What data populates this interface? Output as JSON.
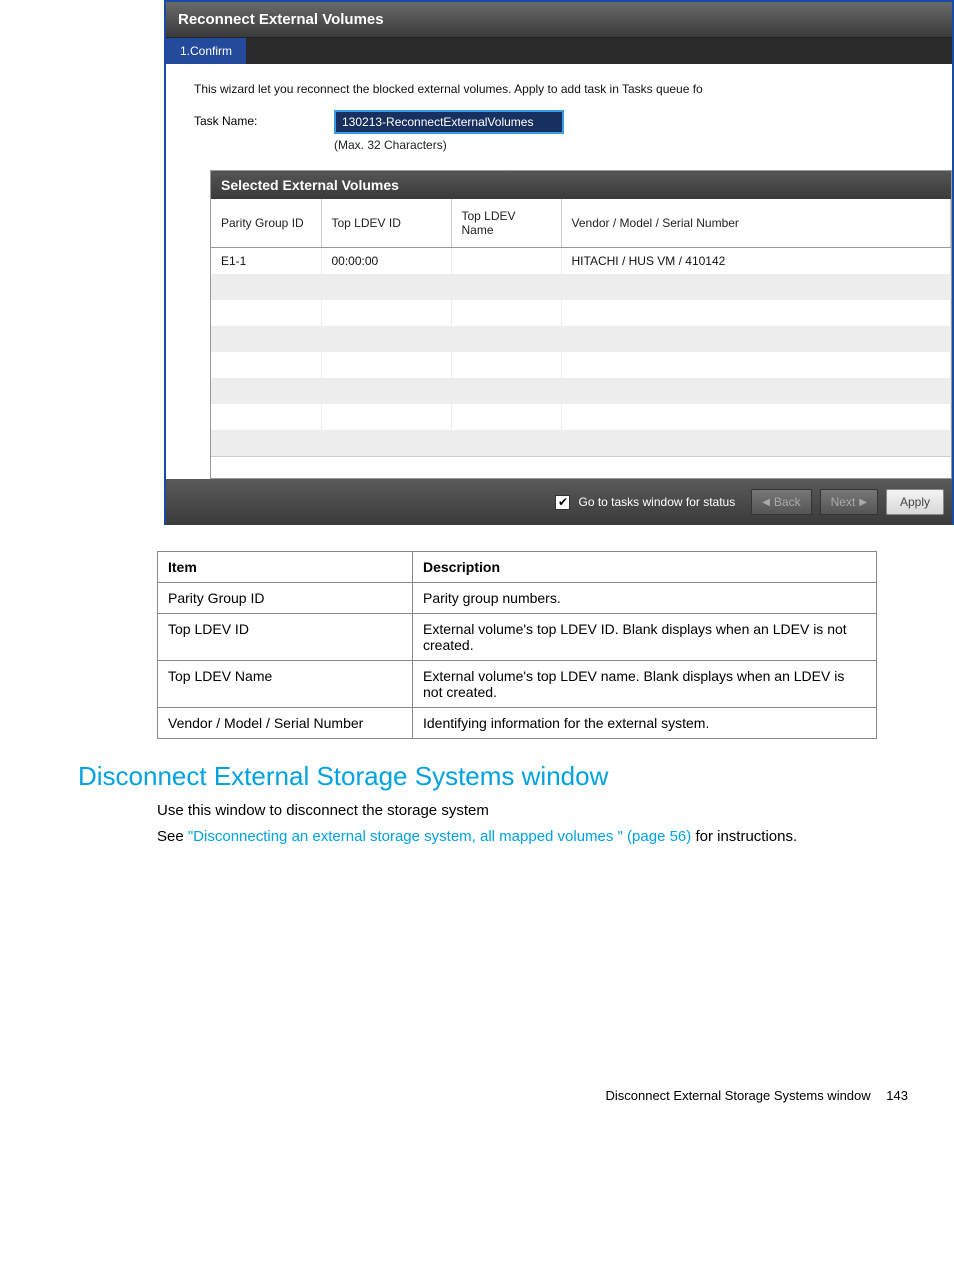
{
  "wizard": {
    "title": "Reconnect External Volumes",
    "tab": "1.Confirm",
    "intro": "This wizard let you reconnect the blocked external volumes. Apply to add task in Tasks queue fo",
    "task_label": "Task Name:",
    "task_value": "130213-ReconnectExternalVolumes",
    "task_hint": "(Max. 32 Characters)",
    "selected_title": "Selected External Volumes",
    "columns": {
      "pg": "Parity Group ID",
      "ldevid": "Top LDEV ID",
      "ldevname": "Top LDEV Name",
      "vms": "Vendor / Model / Serial Number"
    },
    "rows": [
      {
        "pg": "E1-1",
        "ldevid": "00:00:00",
        "ldevname": "",
        "vms": "HITACHI / HUS VM / 410142"
      },
      {
        "pg": "",
        "ldevid": "",
        "ldevname": "",
        "vms": ""
      },
      {
        "pg": "",
        "ldevid": "",
        "ldevname": "",
        "vms": ""
      },
      {
        "pg": "",
        "ldevid": "",
        "ldevname": "",
        "vms": ""
      },
      {
        "pg": "",
        "ldevid": "",
        "ldevname": "",
        "vms": ""
      },
      {
        "pg": "",
        "ldevid": "",
        "ldevname": "",
        "vms": ""
      },
      {
        "pg": "",
        "ldevid": "",
        "ldevname": "",
        "vms": ""
      },
      {
        "pg": "",
        "ldevid": "",
        "ldevname": "",
        "vms": ""
      }
    ],
    "footer_check_label": "Go to tasks window for status",
    "back_label": "Back",
    "next_label": "Next",
    "apply_label": "Apply"
  },
  "desc": {
    "h_item": "Item",
    "h_desc": "Description",
    "rows": [
      {
        "item": "Parity Group ID",
        "desc": "Parity group numbers."
      },
      {
        "item": "Top LDEV ID",
        "desc": "External volume's top LDEV ID. Blank displays when an LDEV is not created."
      },
      {
        "item": "Top LDEV Name",
        "desc": "External volume's top LDEV name. Blank displays when an LDEV is not created."
      },
      {
        "item": "Vendor / Model / Serial Number",
        "desc": "Identifying information for the external system."
      }
    ]
  },
  "doc": {
    "heading": "Disconnect External Storage Systems window",
    "line1": "Use this window to disconnect the storage system",
    "line2_pre": "See ",
    "line2_link": "\"Disconnecting an external storage system, all mapped volumes \" (page 56)",
    "line2_post": " for instructions.",
    "footer_title": "Disconnect External Storage Systems window",
    "page_num": "143"
  }
}
